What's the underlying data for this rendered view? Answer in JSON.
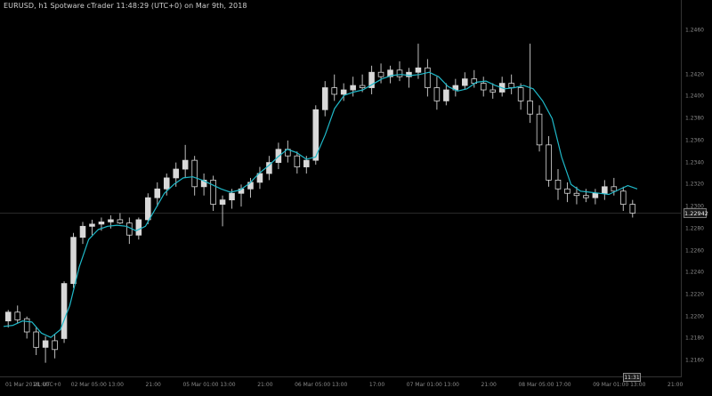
{
  "header": {
    "title": "EURUSD, h1 Spotware cTrader 11:48:29 (UTC+0) on Mar 9th, 2018"
  },
  "colors": {
    "background": "#000000",
    "candle_up": "#d8d8d8",
    "candle_down": "#000000",
    "wick": "#bdbdbd",
    "ma_line": "#1fb8c8"
  },
  "current_price": {
    "label": "1.22942",
    "value": 1.22942
  },
  "current_time": {
    "label": "11:31"
  },
  "chart_data": {
    "type": "candlestick",
    "y_axis": {
      "ticks": [
        1.246,
        1.242,
        1.24,
        1.238,
        1.236,
        1.234,
        1.232,
        1.23,
        1.228,
        1.226,
        1.224,
        1.222,
        1.22,
        1.218,
        1.216
      ],
      "tick_labels": [
        "1.2460",
        "1.2420",
        "1.2400",
        "1.2380",
        "1.2360",
        "1.2340",
        "1.2320",
        "1.2300",
        "1.2280",
        "1.2260",
        "1.2240",
        "1.2220",
        "1.2200",
        "1.2180",
        "1.2160"
      ],
      "ylim": [
        1.2148,
        1.2478
      ]
    },
    "x_axis": {
      "tick_labels": [
        "01 Mar 2018, UTC+0",
        "21:00",
        "02 Mar 05:00",
        "13:00",
        "21:00",
        "05 Mar 01:00",
        "13:00",
        "21:00",
        "06 Mar 05:00",
        "13:00",
        "17:00",
        "07 Mar 01:00",
        "13:00",
        "21:00",
        "08 Mar 05:00",
        "17:00",
        "09 Mar 01:00",
        "13:00",
        "21:00"
      ]
    },
    "moving_average": [
      1.2191,
      1.2192,
      1.2196,
      1.2195,
      1.2185,
      1.2181,
      1.2188,
      1.221,
      1.2245,
      1.227,
      1.2279,
      1.2282,
      1.2283,
      1.2282,
      1.2278,
      1.2282,
      1.2297,
      1.2312,
      1.232,
      1.2326,
      1.2327,
      1.2324,
      1.232,
      1.2316,
      1.2313,
      1.2315,
      1.2321,
      1.233,
      1.2337,
      1.2345,
      1.2352,
      1.2349,
      1.2343,
      1.2345,
      1.2365,
      1.2389,
      1.2401,
      1.2404,
      1.2406,
      1.2411,
      1.2416,
      1.2419,
      1.242,
      1.2419,
      1.242,
      1.2422,
      1.2418,
      1.2409,
      1.2405,
      1.2407,
      1.2413,
      1.2414,
      1.241,
      1.2407,
      1.2408,
      1.241,
      1.2407,
      1.2396,
      1.238,
      1.2345,
      1.232,
      1.2314,
      1.2313,
      1.2312,
      1.2311,
      1.2315,
      1.2319,
      1.2316
    ],
    "candles": [
      {
        "o": 1.2196,
        "h": 1.2206,
        "l": 1.219,
        "c": 1.2204
      },
      {
        "o": 1.2204,
        "h": 1.221,
        "l": 1.2194,
        "c": 1.2197
      },
      {
        "o": 1.2198,
        "h": 1.22,
        "l": 1.218,
        "c": 1.2186
      },
      {
        "o": 1.2186,
        "h": 1.219,
        "l": 1.2165,
        "c": 1.2172
      },
      {
        "o": 1.2172,
        "h": 1.2182,
        "l": 1.2158,
        "c": 1.2178
      },
      {
        "o": 1.2178,
        "h": 1.2184,
        "l": 1.2162,
        "c": 1.217
      },
      {
        "o": 1.218,
        "h": 1.2232,
        "l": 1.2176,
        "c": 1.223
      },
      {
        "o": 1.223,
        "h": 1.2276,
        "l": 1.2226,
        "c": 1.2272
      },
      {
        "o": 1.2272,
        "h": 1.2286,
        "l": 1.2266,
        "c": 1.2282
      },
      {
        "o": 1.2282,
        "h": 1.2288,
        "l": 1.2274,
        "c": 1.2284
      },
      {
        "o": 1.2284,
        "h": 1.229,
        "l": 1.2278,
        "c": 1.2286
      },
      {
        "o": 1.2286,
        "h": 1.2292,
        "l": 1.228,
        "c": 1.2288
      },
      {
        "o": 1.2288,
        "h": 1.2294,
        "l": 1.2284,
        "c": 1.2285
      },
      {
        "o": 1.2285,
        "h": 1.229,
        "l": 1.2266,
        "c": 1.2274
      },
      {
        "o": 1.2274,
        "h": 1.229,
        "l": 1.227,
        "c": 1.2288
      },
      {
        "o": 1.2288,
        "h": 1.2312,
        "l": 1.2284,
        "c": 1.2308
      },
      {
        "o": 1.2308,
        "h": 1.2322,
        "l": 1.23,
        "c": 1.2316
      },
      {
        "o": 1.2316,
        "h": 1.233,
        "l": 1.231,
        "c": 1.2326
      },
      {
        "o": 1.2326,
        "h": 1.234,
        "l": 1.2318,
        "c": 1.2334
      },
      {
        "o": 1.2334,
        "h": 1.2356,
        "l": 1.2326,
        "c": 1.2342
      },
      {
        "o": 1.2342,
        "h": 1.2346,
        "l": 1.231,
        "c": 1.2318
      },
      {
        "o": 1.2318,
        "h": 1.233,
        "l": 1.231,
        "c": 1.2324
      },
      {
        "o": 1.2324,
        "h": 1.2328,
        "l": 1.2296,
        "c": 1.2302
      },
      {
        "o": 1.2302,
        "h": 1.231,
        "l": 1.2282,
        "c": 1.2306
      },
      {
        "o": 1.2306,
        "h": 1.2316,
        "l": 1.2298,
        "c": 1.2312
      },
      {
        "o": 1.2312,
        "h": 1.232,
        "l": 1.23,
        "c": 1.2316
      },
      {
        "o": 1.2316,
        "h": 1.2326,
        "l": 1.2308,
        "c": 1.2322
      },
      {
        "o": 1.2322,
        "h": 1.2336,
        "l": 1.2316,
        "c": 1.233
      },
      {
        "o": 1.233,
        "h": 1.2346,
        "l": 1.2324,
        "c": 1.234
      },
      {
        "o": 1.234,
        "h": 1.2358,
        "l": 1.2334,
        "c": 1.2352
      },
      {
        "o": 1.2352,
        "h": 1.236,
        "l": 1.234,
        "c": 1.2346
      },
      {
        "o": 1.2346,
        "h": 1.235,
        "l": 1.233,
        "c": 1.2336
      },
      {
        "o": 1.2336,
        "h": 1.2346,
        "l": 1.233,
        "c": 1.2342
      },
      {
        "o": 1.2342,
        "h": 1.2392,
        "l": 1.2338,
        "c": 1.2388
      },
      {
        "o": 1.2388,
        "h": 1.2414,
        "l": 1.2382,
        "c": 1.2408
      },
      {
        "o": 1.2408,
        "h": 1.242,
        "l": 1.2396,
        "c": 1.2402
      },
      {
        "o": 1.2402,
        "h": 1.2412,
        "l": 1.2396,
        "c": 1.2406
      },
      {
        "o": 1.2406,
        "h": 1.2418,
        "l": 1.24,
        "c": 1.241
      },
      {
        "o": 1.241,
        "h": 1.242,
        "l": 1.2404,
        "c": 1.2408
      },
      {
        "o": 1.2408,
        "h": 1.2428,
        "l": 1.2402,
        "c": 1.2422
      },
      {
        "o": 1.2422,
        "h": 1.243,
        "l": 1.2412,
        "c": 1.2418
      },
      {
        "o": 1.2418,
        "h": 1.2428,
        "l": 1.2412,
        "c": 1.2424
      },
      {
        "o": 1.2424,
        "h": 1.2432,
        "l": 1.2414,
        "c": 1.2418
      },
      {
        "o": 1.2418,
        "h": 1.2426,
        "l": 1.2408,
        "c": 1.2422
      },
      {
        "o": 1.2422,
        "h": 1.2448,
        "l": 1.2416,
        "c": 1.2426
      },
      {
        "o": 1.2426,
        "h": 1.2434,
        "l": 1.24,
        "c": 1.2408
      },
      {
        "o": 1.2408,
        "h": 1.2418,
        "l": 1.2388,
        "c": 1.2396
      },
      {
        "o": 1.2396,
        "h": 1.2412,
        "l": 1.2392,
        "c": 1.2406
      },
      {
        "o": 1.2406,
        "h": 1.2416,
        "l": 1.24,
        "c": 1.241
      },
      {
        "o": 1.241,
        "h": 1.2422,
        "l": 1.2406,
        "c": 1.2416
      },
      {
        "o": 1.2416,
        "h": 1.2424,
        "l": 1.2408,
        "c": 1.2412
      },
      {
        "o": 1.2412,
        "h": 1.2418,
        "l": 1.24,
        "c": 1.2406
      },
      {
        "o": 1.2406,
        "h": 1.2412,
        "l": 1.2398,
        "c": 1.2404
      },
      {
        "o": 1.2404,
        "h": 1.2418,
        "l": 1.24,
        "c": 1.2412
      },
      {
        "o": 1.2412,
        "h": 1.242,
        "l": 1.2402,
        "c": 1.2408
      },
      {
        "o": 1.2408,
        "h": 1.2412,
        "l": 1.2388,
        "c": 1.2396
      },
      {
        "o": 1.2396,
        "h": 1.2448,
        "l": 1.2376,
        "c": 1.2384
      },
      {
        "o": 1.2384,
        "h": 1.2392,
        "l": 1.235,
        "c": 1.2356
      },
      {
        "o": 1.2356,
        "h": 1.2364,
        "l": 1.2318,
        "c": 1.2324
      },
      {
        "o": 1.2324,
        "h": 1.2334,
        "l": 1.2306,
        "c": 1.2316
      },
      {
        "o": 1.2316,
        "h": 1.2322,
        "l": 1.2304,
        "c": 1.2312
      },
      {
        "o": 1.2312,
        "h": 1.2318,
        "l": 1.2302,
        "c": 1.231
      },
      {
        "o": 1.231,
        "h": 1.2316,
        "l": 1.2304,
        "c": 1.2308
      },
      {
        "o": 1.2308,
        "h": 1.2316,
        "l": 1.2302,
        "c": 1.2312
      },
      {
        "o": 1.2312,
        "h": 1.2324,
        "l": 1.2306,
        "c": 1.2318
      },
      {
        "o": 1.2318,
        "h": 1.2326,
        "l": 1.231,
        "c": 1.2314
      },
      {
        "o": 1.2314,
        "h": 1.2318,
        "l": 1.2296,
        "c": 1.2302
      },
      {
        "o": 1.2302,
        "h": 1.2306,
        "l": 1.229,
        "c": 1.2294
      }
    ]
  }
}
